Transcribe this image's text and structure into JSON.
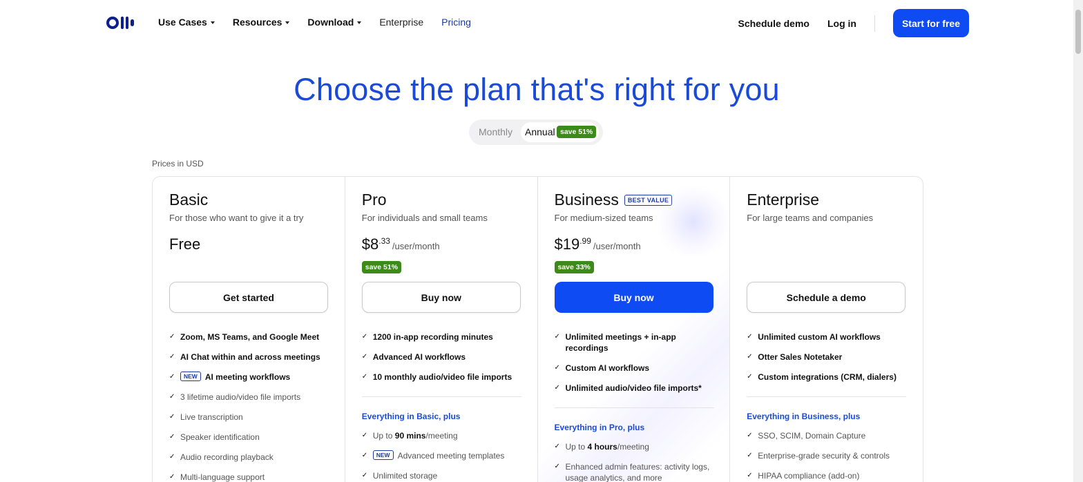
{
  "nav": {
    "items": [
      {
        "label": "Use Cases",
        "caret": true
      },
      {
        "label": "Resources",
        "caret": true
      },
      {
        "label": "Download",
        "caret": true
      },
      {
        "label": "Enterprise",
        "caret": false
      },
      {
        "label": "Pricing",
        "caret": false
      }
    ],
    "schedule_demo": "Schedule demo",
    "login": "Log in",
    "cta": "Start for free"
  },
  "hero": {
    "title": "Choose the plan that's right for you",
    "toggle": {
      "monthly": "Monthly",
      "annual": "Annual",
      "annual_badge": "save 51%",
      "selected": "Annual"
    }
  },
  "prices_note": "Prices in USD",
  "plans": [
    {
      "name": "Basic",
      "desc": "For those who want to give it a try",
      "price_text": "Free",
      "button": "Get started",
      "features": [
        "Zoom, MS Teams, and Google Meet",
        "AI Chat within and across meetings",
        "AI meeting workflows",
        "3 lifetime audio/video file imports",
        "Live transcription",
        "Speaker identification",
        "Audio recording playback",
        "Multi-language support"
      ],
      "new_tag": "NEW"
    },
    {
      "name": "Pro",
      "desc": "For individuals and small teams",
      "price_main": "$8",
      "price_cents": ".33",
      "price_per": "/user/month",
      "save": "save 51%",
      "button": "Buy now",
      "features": [
        "1200 in-app recording minutes",
        "Advanced AI workflows",
        "10 monthly audio/video file imports"
      ],
      "plus_heading": "Everything in Basic, plus",
      "plus_features": [
        {
          "pre": "Up to ",
          "strong": "90 mins",
          "post": "/meeting"
        },
        {
          "tag": "NEW",
          "text": "Advanced meeting templates"
        },
        {
          "text": "Unlimited storage"
        }
      ]
    },
    {
      "name": "Business",
      "badge": "BEST VALUE",
      "desc": "For medium-sized teams",
      "price_main": "$19",
      "price_cents": ".99",
      "price_per": "/user/month",
      "save": "save 33%",
      "button": "Buy now",
      "features": [
        "Unlimited meetings + in-app recordings",
        "Custom AI workflows",
        "Unlimited audio/video file imports*"
      ],
      "plus_heading": "Everything in Pro, plus",
      "plus_features": [
        {
          "pre": "Up to ",
          "strong": "4 hours",
          "post": "/meeting"
        },
        {
          "text": "Enhanced admin features: activity logs, usage analytics, and more"
        }
      ]
    },
    {
      "name": "Enterprise",
      "desc": "For large teams and companies",
      "button": "Schedule a demo",
      "features": [
        "Unlimited custom AI workflows",
        "Otter Sales Notetaker",
        "Custom integrations (CRM, dialers)"
      ],
      "plus_heading": "Everything in Business, plus",
      "plus_features": [
        {
          "text": "SSO, SCIM, Domain Capture"
        },
        {
          "text": "Enterprise-grade security & controls"
        },
        {
          "text": "HIPAA compliance (add-on)"
        }
      ]
    }
  ],
  "colors": {
    "brand_blue": "#0f4bf2",
    "title_blue": "#1a4ad6",
    "save_green": "#3c8a1a",
    "logo_navy": "#0b1f8e"
  }
}
